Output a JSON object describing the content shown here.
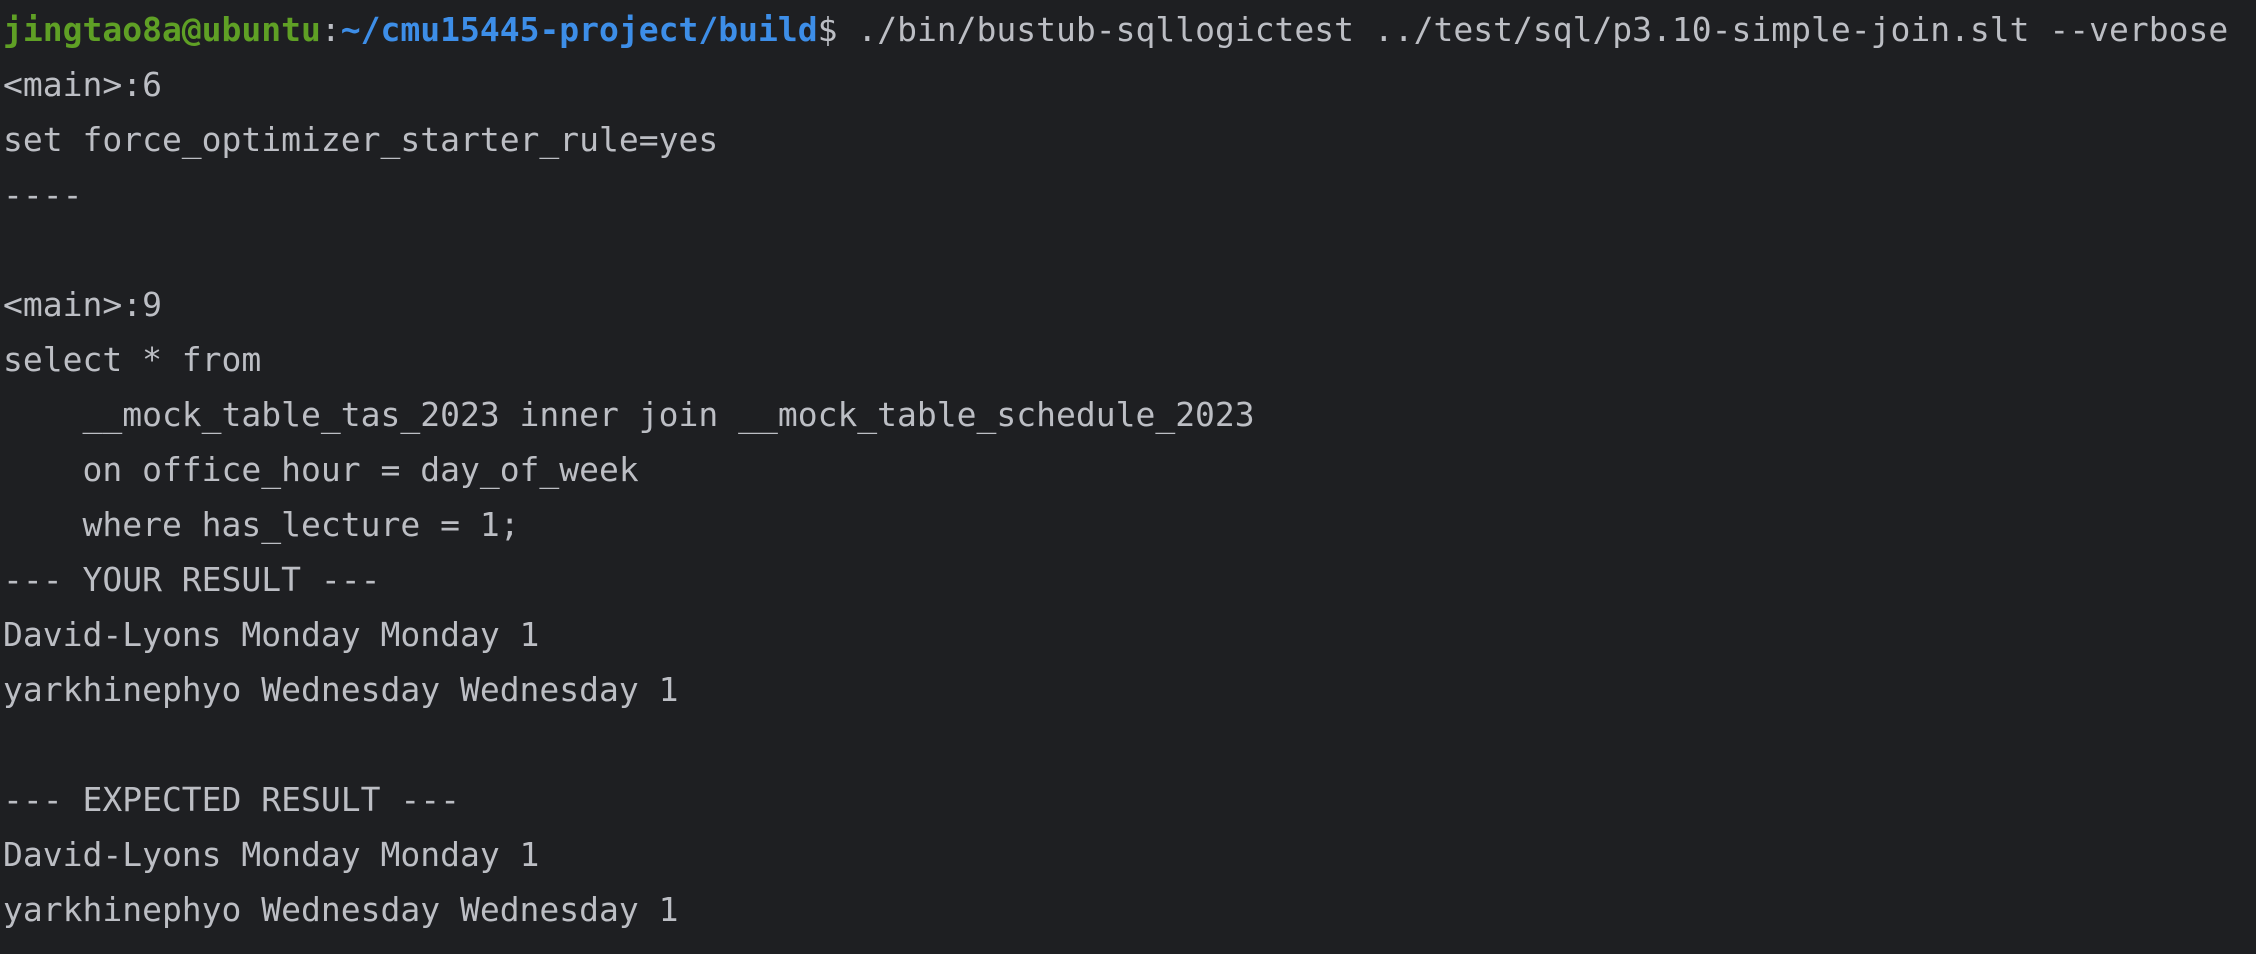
{
  "terminal": {
    "prompt": {
      "user_host": "jingtao8a@ubuntu",
      "separator": ":",
      "path": "~/cmu15445-project/build",
      "dollar": "$",
      "command": " ./bin/bustub-sqllogictest ../test/sql/p3.10-simple-join.slt --verbose"
    },
    "lines": [
      "<main>:6",
      "set force_optimizer_starter_rule=yes",
      "----",
      "",
      "<main>:9",
      "select * from",
      "    __mock_table_tas_2023 inner join __mock_table_schedule_2023",
      "    on office_hour = day_of_week",
      "    where has_lecture = 1;",
      "--- YOUR RESULT ---",
      "David-Lyons Monday Monday 1",
      "yarkhinephyo Wednesday Wednesday 1",
      "",
      "--- EXPECTED RESULT ---",
      "David-Lyons Monday Monday 1",
      "yarkhinephyo Wednesday Wednesday 1"
    ],
    "colors": {
      "background": "#1e1f22",
      "text": "#bcbec4",
      "user_host": "#5fa025",
      "path": "#3d8ee8"
    }
  }
}
